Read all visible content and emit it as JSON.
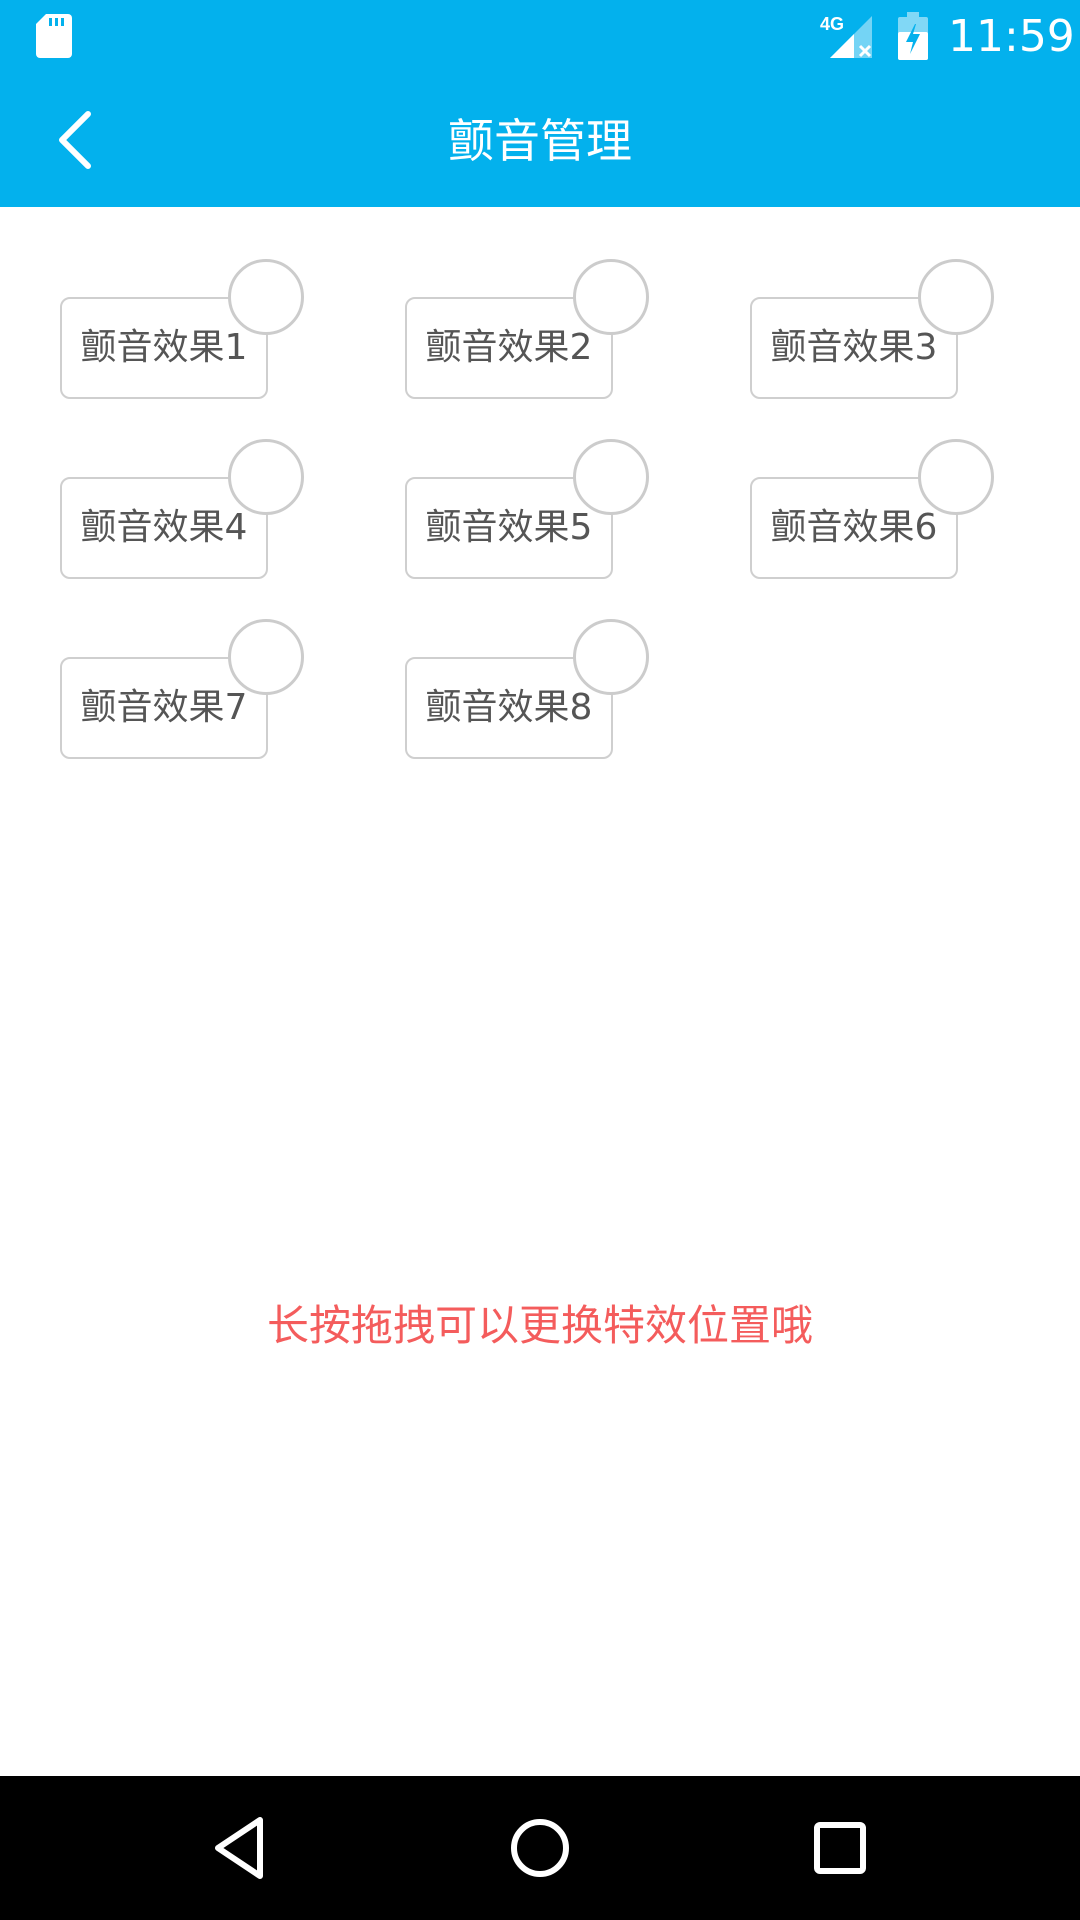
{
  "status_bar": {
    "time": "11:59",
    "network_label": "4G",
    "icons": [
      "sd-card-icon",
      "signal-no-service-icon",
      "battery-charging-icon"
    ]
  },
  "app_bar": {
    "title": "颤音管理",
    "back_icon": "chevron-left-icon"
  },
  "effects": [
    {
      "label": "颤音效果1",
      "selected": false
    },
    {
      "label": "颤音效果2",
      "selected": false
    },
    {
      "label": "颤音效果3",
      "selected": false
    },
    {
      "label": "颤音效果4",
      "selected": false
    },
    {
      "label": "颤音效果5",
      "selected": false
    },
    {
      "label": "颤音效果6",
      "selected": false
    },
    {
      "label": "颤音效果7",
      "selected": false
    },
    {
      "label": "颤音效果8",
      "selected": false
    }
  ],
  "hint": "长按拖拽可以更换特效位置哦",
  "nav_bar": {
    "icons": [
      "back-triangle-icon",
      "home-circle-icon",
      "recents-square-icon"
    ]
  },
  "colors": {
    "primary": "#03b1ed",
    "hint": "#f45c5c",
    "chip_border": "#cfcfcf",
    "chip_text": "#555555",
    "nav_background": "#000000"
  }
}
